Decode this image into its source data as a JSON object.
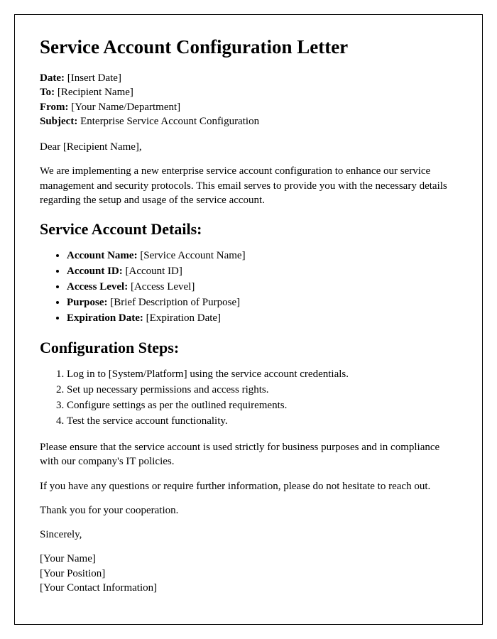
{
  "title": "Service Account Configuration Letter",
  "header": {
    "date_label": "Date:",
    "date_value": " [Insert Date]",
    "to_label": "To:",
    "to_value": " [Recipient Name]",
    "from_label": "From:",
    "from_value": " [Your Name/Department]",
    "subject_label": "Subject:",
    "subject_value": " Enterprise Service Account Configuration"
  },
  "salutation": "Dear [Recipient Name],",
  "intro": "We are implementing a new enterprise service account configuration to enhance our service management and security protocols. This email serves to provide you with the necessary details regarding the setup and usage of the service account.",
  "details_heading": "Service Account Details:",
  "details": {
    "account_name_label": "Account Name:",
    "account_name_value": " [Service Account Name]",
    "account_id_label": "Account ID:",
    "account_id_value": " [Account ID]",
    "access_level_label": "Access Level:",
    "access_level_value": " [Access Level]",
    "purpose_label": "Purpose:",
    "purpose_value": " [Brief Description of Purpose]",
    "expiration_label": "Expiration Date:",
    "expiration_value": " [Expiration Date]"
  },
  "steps_heading": "Configuration Steps:",
  "steps": {
    "s1": "Log in to [System/Platform] using the service account credentials.",
    "s2": "Set up necessary permissions and access rights.",
    "s3": "Configure settings as per the outlined requirements.",
    "s4": "Test the service account functionality."
  },
  "compliance": "Please ensure that the service account is used strictly for business purposes and in compliance with our company's IT policies.",
  "questions": "If you have any questions or require further information, please do not hesitate to reach out.",
  "thanks": "Thank you for your cooperation.",
  "closing": "Sincerely,",
  "signature": {
    "name": "[Your Name]",
    "position": "[Your Position]",
    "contact": "[Your Contact Information]"
  }
}
